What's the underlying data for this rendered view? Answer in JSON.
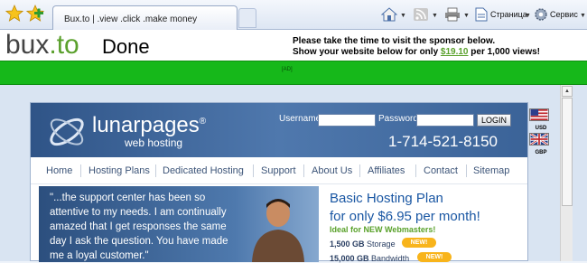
{
  "browser": {
    "tab_title": "Bux.to | .view .click .make money",
    "toolbar": {
      "page_label": "Страница",
      "tools_label": "Сервис"
    }
  },
  "bux": {
    "logo_main": "bux",
    "logo_dot_to": ".to",
    "status": "Done",
    "sponsor_line1": "Please take the time to visit the sponsor below.",
    "sponsor_line2_pre": "Show your website below for only ",
    "sponsor_price": "$19.10",
    "sponsor_line2_post": " per 1,000 views!",
    "ad_label": "[AD]"
  },
  "flags": [
    {
      "label": "USD"
    },
    {
      "label": "GBP"
    }
  ],
  "site": {
    "logo": "lunarpages",
    "logo_mark": "®",
    "subtitle": "web hosting",
    "username_label": "Username:",
    "password_label": "Password:",
    "login_button": "LOGIN",
    "phone": "1-714-521-8150",
    "nav": [
      "Home",
      "Hosting Plans",
      "Dedicated Hosting",
      "Support",
      "About Us",
      "Affiliates",
      "Contact",
      "Sitemap"
    ],
    "testimonial": "\"...the support center has been so attentive to my needs. I am continually amazed that I get responses the same day I ask the question. You have made me a loyal customer.\"",
    "plan_title_line1": "Basic Hosting Plan",
    "plan_title_line2": "for only $6.95 per month!",
    "ideal": "Ideal for NEW Webmasters!",
    "features": [
      {
        "amount": "1,500 GB",
        "label": "Storage",
        "badge": "NEW!"
      },
      {
        "amount": "15,000 GB",
        "label": "Bandwidth",
        "badge": "NEW!"
      }
    ]
  },
  "colors": {
    "bux_green": "#5aa02c",
    "ad_bar": "#16b81a",
    "lp_blue": "#2f5487",
    "plan_blue": "#1a57a3",
    "badge_orange": "#f8b41b"
  }
}
